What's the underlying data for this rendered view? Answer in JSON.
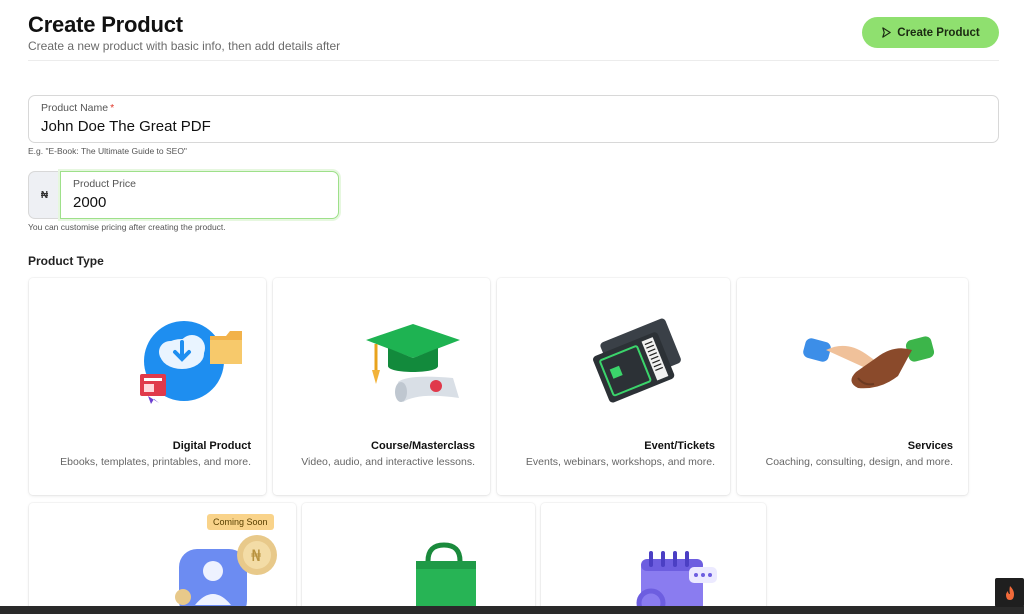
{
  "header": {
    "title": "Create Product",
    "subtitle": "Create a new product with basic info, then add details after",
    "create_button": "Create Product"
  },
  "form": {
    "name": {
      "label": "Product Name",
      "required_mark": "*",
      "value": "John Doe The Great PDF",
      "hint": "E.g. \"E-Book: The Ultimate Guide to SEO\""
    },
    "price": {
      "currency_symbol": "₦",
      "label": "Product Price",
      "value": "2000",
      "hint": "You can customise pricing after creating the product."
    }
  },
  "product_type": {
    "section_title": "Product Type",
    "cards": [
      {
        "title": "Digital Product",
        "description": "Ebooks, templates, printables, and more.",
        "icon": "cloud-download-icon"
      },
      {
        "title": "Course/Masterclass",
        "description": "Video, audio, and interactive lessons.",
        "icon": "graduation-cap-icon"
      },
      {
        "title": "Event/Tickets",
        "description": "Events, webinars, workshops, and more.",
        "icon": "tickets-icon"
      },
      {
        "title": "Services",
        "description": "Coaching, consulting, design, and more.",
        "icon": "handshake-icon"
      }
    ],
    "row2": [
      {
        "badge": "Coming Soon",
        "icon": "community-icon"
      },
      {
        "icon": "shopping-bag-icon"
      },
      {
        "icon": "calendar-icon"
      }
    ]
  },
  "colors": {
    "accent": "#8fe06f",
    "focus_border": "#9ee08a",
    "badge": "#f9d38a",
    "required": "#e0392b"
  }
}
